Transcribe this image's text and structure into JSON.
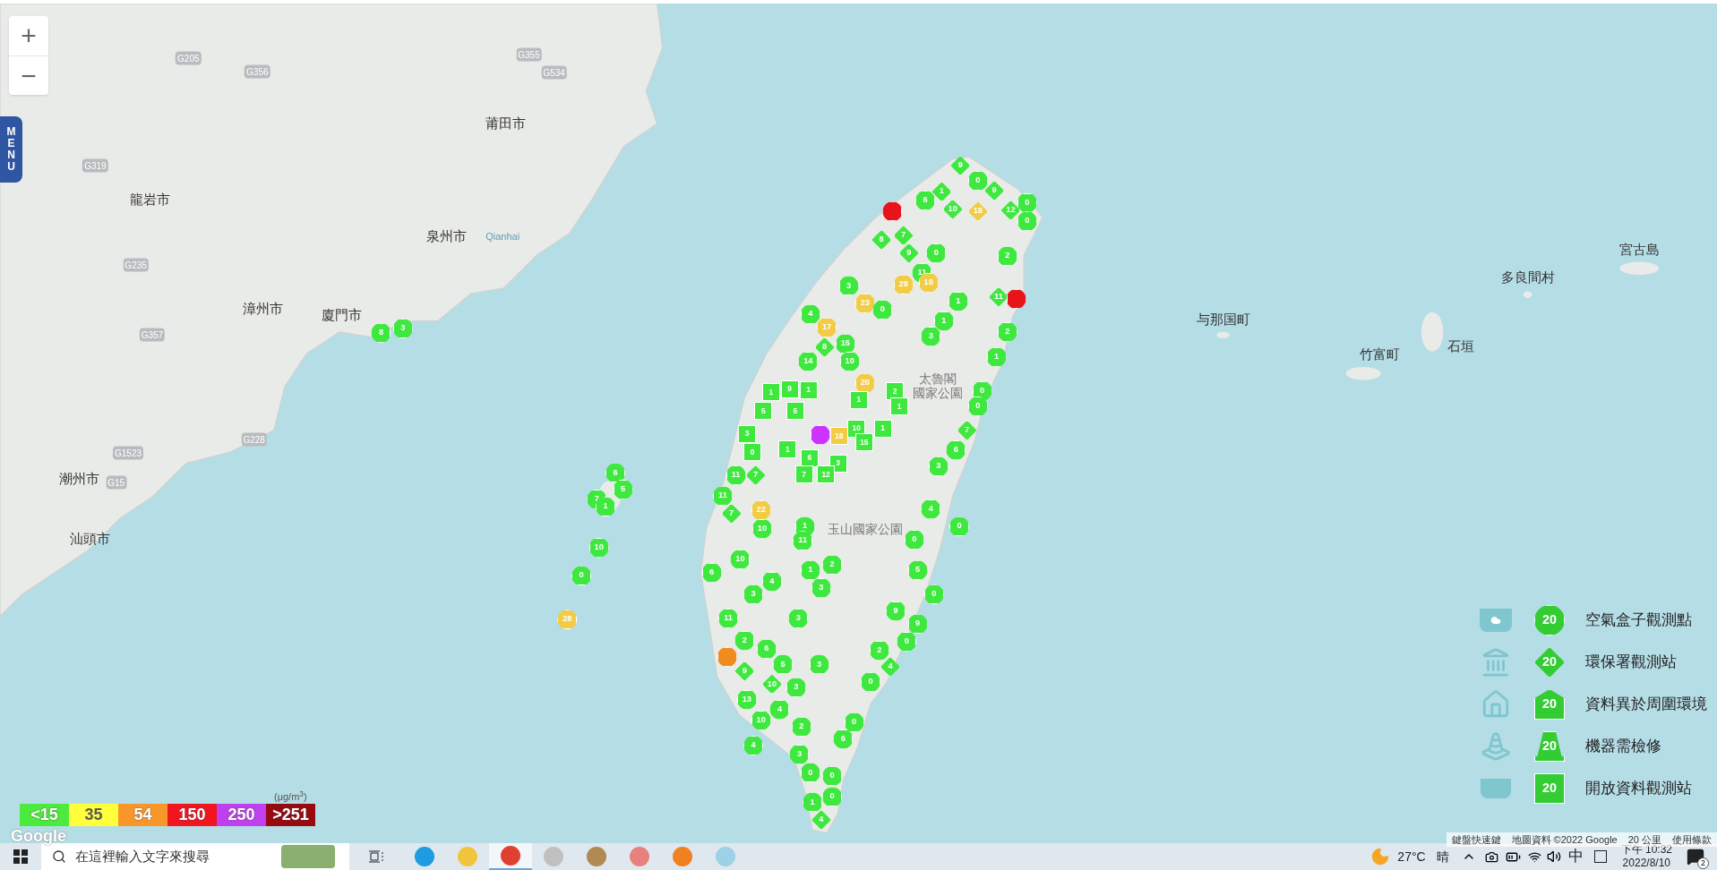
{
  "map": {
    "zoom_controls": {
      "zoom_in": "+",
      "zoom_out": "−"
    },
    "menu_button": "MENU",
    "places": [
      {
        "name": "莆田市",
        "kind": "city"
      },
      {
        "name": "龍岩市",
        "kind": "city"
      },
      {
        "name": "泉州市",
        "kind": "city"
      },
      {
        "name": "Qianhai",
        "kind": "water"
      },
      {
        "name": "漳州市",
        "kind": "city"
      },
      {
        "name": "廈門市",
        "kind": "city"
      },
      {
        "name": "潮州市",
        "kind": "city"
      },
      {
        "name": "汕頭市",
        "kind": "city"
      },
      {
        "name": "宮古島",
        "kind": "city"
      },
      {
        "name": "多良間村",
        "kind": "city"
      },
      {
        "name": "与那国町",
        "kind": "city"
      },
      {
        "name": "竹富町",
        "kind": "city"
      },
      {
        "name": "石垣",
        "kind": "city"
      },
      {
        "name": "太魯閣",
        "kind": "park"
      },
      {
        "name": "國家公園",
        "kind": "park"
      },
      {
        "name": "玉山國家公園",
        "kind": "park"
      },
      {
        "name": "G205",
        "kind": "road"
      },
      {
        "name": "G356",
        "kind": "road"
      },
      {
        "name": "G355",
        "kind": "road"
      },
      {
        "name": "G534",
        "kind": "road"
      },
      {
        "name": "G319",
        "kind": "road"
      },
      {
        "name": "G235",
        "kind": "road"
      },
      {
        "name": "G357",
        "kind": "road"
      },
      {
        "name": "G1523",
        "kind": "road"
      },
      {
        "name": "G15",
        "kind": "road"
      },
      {
        "name": "G228",
        "kind": "road"
      }
    ],
    "markers": [
      {
        "kind": "diamond",
        "value": "9",
        "color": "#3fe83f"
      },
      {
        "kind": "circle",
        "value": "0",
        "color": "#3fe83f"
      },
      {
        "kind": "diamond",
        "value": "9",
        "color": "#3fe83f"
      },
      {
        "kind": "diamond",
        "value": "12",
        "color": "#3fe83f"
      },
      {
        "kind": "circle",
        "value": "0",
        "color": "#3fe83f"
      },
      {
        "kind": "circle",
        "value": "0",
        "color": "#3fe83f"
      },
      {
        "kind": "diamond",
        "value": "10",
        "color": "#3fe83f"
      },
      {
        "kind": "diamond",
        "value": "18",
        "color": "#f2cc45"
      },
      {
        "kind": "diamond",
        "value": "1",
        "color": "#3fe83f"
      },
      {
        "kind": "circle",
        "value": "6",
        "color": "#3fe83f"
      },
      {
        "kind": "diamond",
        "value": "7",
        "color": "#3fe83f"
      },
      {
        "kind": "diamond",
        "value": "8",
        "color": "#3fe83f"
      },
      {
        "kind": "diamond",
        "value": "9",
        "color": "#3fe83f"
      },
      {
        "kind": "circle",
        "value": "11",
        "color": "#3fe83f"
      },
      {
        "kind": "circle",
        "value": "28",
        "color": "#f2cc45"
      },
      {
        "kind": "circle",
        "value": "18",
        "color": "#f2cc45"
      },
      {
        "kind": "circle",
        "value": "0",
        "color": "#3fe83f"
      },
      {
        "kind": "circle",
        "value": "2",
        "color": "#3fe83f"
      },
      {
        "kind": "diamond",
        "value": "11",
        "color": "#3fe83f"
      },
      {
        "kind": "circle",
        "value": "2",
        "color": "#3fe83f"
      },
      {
        "kind": "circle",
        "value": "0",
        "color": "#3fe83f"
      },
      {
        "kind": "circle",
        "value": "1",
        "color": "#3fe83f"
      },
      {
        "kind": "circle",
        "value": "1",
        "color": "#3fe83f"
      },
      {
        "kind": "circle",
        "value": "3",
        "color": "#3fe83f"
      },
      {
        "kind": "circle",
        "value": "3",
        "color": "#3fe83f"
      },
      {
        "kind": "circle",
        "value": "23",
        "color": "#f2cc45"
      },
      {
        "kind": "circle",
        "value": "0",
        "color": "#3fe83f"
      },
      {
        "kind": "circle",
        "value": "4",
        "color": "#3fe83f"
      },
      {
        "kind": "circle",
        "value": "17",
        "color": "#f2cc45"
      },
      {
        "kind": "diamond",
        "value": "8",
        "color": "#3fe83f"
      },
      {
        "kind": "circle",
        "value": "15",
        "color": "#3fe83f"
      },
      {
        "kind": "circle",
        "value": "14",
        "color": "#3fe83f"
      },
      {
        "kind": "circle",
        "value": "10",
        "color": "#3fe83f"
      },
      {
        "kind": "circle",
        "value": "20",
        "color": "#f2cc45"
      },
      {
        "kind": "square",
        "value": "2",
        "color": "#3fe83f"
      },
      {
        "kind": "square",
        "value": "1",
        "color": "#3fe83f"
      },
      {
        "kind": "square",
        "value": "1",
        "color": "#3fe83f"
      },
      {
        "kind": "square",
        "value": "10",
        "color": "#3fe83f"
      },
      {
        "kind": "square",
        "value": "1",
        "color": "#3fe83f"
      },
      {
        "kind": "square",
        "value": "15",
        "color": "#3fe83f"
      },
      {
        "kind": "square",
        "value": "18",
        "color": "#f2cc45"
      },
      {
        "kind": "square",
        "value": "1",
        "color": "#3fe83f"
      },
      {
        "kind": "square",
        "value": "9",
        "color": "#3fe83f"
      },
      {
        "kind": "square",
        "value": "1",
        "color": "#3fe83f"
      },
      {
        "kind": "square",
        "value": "5",
        "color": "#3fe83f"
      },
      {
        "kind": "square",
        "value": "5",
        "color": "#3fe83f"
      },
      {
        "kind": "square",
        "value": "3",
        "color": "#3fe83f"
      },
      {
        "kind": "square",
        "value": "0",
        "color": "#3fe83f"
      },
      {
        "kind": "square",
        "value": "1",
        "color": "#3fe83f"
      },
      {
        "kind": "square",
        "value": "6",
        "color": "#3fe83f"
      },
      {
        "kind": "square",
        "value": "3",
        "color": "#3fe83f"
      },
      {
        "kind": "circle",
        "value": "11",
        "color": "#3fe83f"
      },
      {
        "kind": "diamond",
        "value": "7",
        "color": "#3fe83f"
      },
      {
        "kind": "square",
        "value": "7",
        "color": "#3fe83f"
      },
      {
        "kind": "square",
        "value": "12",
        "color": "#3fe83f"
      },
      {
        "kind": "circle",
        "value": "11",
        "color": "#3fe83f"
      },
      {
        "kind": "diamond",
        "value": "7",
        "color": "#3fe83f"
      },
      {
        "kind": "circle",
        "value": "10",
        "color": "#3fe83f"
      },
      {
        "kind": "circle",
        "value": "1",
        "color": "#3fe83f"
      },
      {
        "kind": "circle",
        "value": "11",
        "color": "#3fe83f"
      },
      {
        "kind": "circle",
        "value": "22",
        "color": "#f2cc45"
      },
      {
        "kind": "circle",
        "value": "6",
        "color": "#3fe83f"
      },
      {
        "kind": "circle",
        "value": "10",
        "color": "#3fe83f"
      },
      {
        "kind": "circle",
        "value": "4",
        "color": "#3fe83f"
      },
      {
        "kind": "circle",
        "value": "1",
        "color": "#3fe83f"
      },
      {
        "kind": "circle",
        "value": "2",
        "color": "#3fe83f"
      },
      {
        "kind": "circle",
        "value": "3",
        "color": "#3fe83f"
      },
      {
        "kind": "circle",
        "value": "3",
        "color": "#3fe83f"
      },
      {
        "kind": "circle",
        "value": "11",
        "color": "#3fe83f"
      },
      {
        "kind": "circle",
        "value": "2",
        "color": "#3fe83f"
      },
      {
        "kind": "circle",
        "value": "6",
        "color": "#3fe83f"
      },
      {
        "kind": "circle",
        "value": "3",
        "color": "#3fe83f"
      },
      {
        "kind": "diamond",
        "value": "9",
        "color": "#3fe83f"
      },
      {
        "kind": "diamond",
        "value": "10",
        "color": "#3fe83f"
      },
      {
        "kind": "circle",
        "value": "5",
        "color": "#3fe83f"
      },
      {
        "kind": "circle",
        "value": "3",
        "color": "#3fe83f"
      },
      {
        "kind": "circle",
        "value": "3",
        "color": "#3fe83f"
      },
      {
        "kind": "circle",
        "value": "13",
        "color": "#3fe83f"
      },
      {
        "kind": "circle",
        "value": "10",
        "color": "#3fe83f"
      },
      {
        "kind": "circle",
        "value": "4",
        "color": "#3fe83f"
      },
      {
        "kind": "circle",
        "value": "2",
        "color": "#3fe83f"
      },
      {
        "kind": "circle",
        "value": "4",
        "color": "#3fe83f"
      },
      {
        "kind": "circle",
        "value": "3",
        "color": "#3fe83f"
      },
      {
        "kind": "circle",
        "value": "6",
        "color": "#3fe83f"
      },
      {
        "kind": "circle",
        "value": "0",
        "color": "#3fe83f"
      },
      {
        "kind": "circle",
        "value": "0",
        "color": "#3fe83f"
      },
      {
        "kind": "circle",
        "value": "0",
        "color": "#3fe83f"
      },
      {
        "kind": "circle",
        "value": "1",
        "color": "#3fe83f"
      },
      {
        "kind": "circle",
        "value": "0",
        "color": "#3fe83f"
      },
      {
        "kind": "diamond",
        "value": "4",
        "color": "#3fe83f"
      },
      {
        "kind": "circle",
        "value": "0",
        "color": "#3fe83f"
      },
      {
        "kind": "circle",
        "value": "4",
        "color": "#3fe83f"
      },
      {
        "kind": "circle",
        "value": "0",
        "color": "#3fe83f"
      },
      {
        "kind": "circle",
        "value": "3",
        "color": "#3fe83f"
      },
      {
        "kind": "circle",
        "value": "6",
        "color": "#3fe83f"
      },
      {
        "kind": "diamond",
        "value": "7",
        "color": "#3fe83f"
      },
      {
        "kind": "circle",
        "value": "0",
        "color": "#3fe83f"
      },
      {
        "kind": "circle",
        "value": "5",
        "color": "#3fe83f"
      },
      {
        "kind": "circle",
        "value": "0",
        "color": "#3fe83f"
      },
      {
        "kind": "circle",
        "value": "9",
        "color": "#3fe83f"
      },
      {
        "kind": "circle",
        "value": "9",
        "color": "#3fe83f"
      },
      {
        "kind": "circle",
        "value": "2",
        "color": "#3fe83f"
      },
      {
        "kind": "circle",
        "value": "0",
        "color": "#3fe83f"
      },
      {
        "kind": "diamond",
        "value": "4",
        "color": "#3fe83f"
      },
      {
        "kind": "circle",
        "value": "0",
        "color": "#3fe83f"
      },
      {
        "kind": "circle",
        "value": "6",
        "color": "#3fe83f"
      },
      {
        "kind": "circle",
        "value": "5",
        "color": "#3fe83f"
      },
      {
        "kind": "circle",
        "value": "7",
        "color": "#3fe83f"
      },
      {
        "kind": "circle",
        "value": "1",
        "color": "#3fe83f"
      },
      {
        "kind": "circle",
        "value": "10",
        "color": "#3fe83f"
      },
      {
        "kind": "circle",
        "value": "0",
        "color": "#3fe83f"
      },
      {
        "kind": "circle",
        "value": "28",
        "color": "#f2cc45"
      },
      {
        "kind": "circle",
        "value": "8",
        "color": "#3fe83f"
      },
      {
        "kind": "circle",
        "value": "3",
        "color": "#3fe83f"
      },
      {
        "kind": "circle",
        "value": "1",
        "color": "#3fe83f"
      },
      {
        "kind": "circle",
        "color": "#e8141c"
      },
      {
        "kind": "circle",
        "color": "#e8141c"
      },
      {
        "kind": "circle",
        "color": "#cc33ff"
      },
      {
        "kind": "circle",
        "color": "#f08c1e"
      }
    ],
    "pm_scale": {
      "unit": "(μg/m$^{3}$)",
      "levels": [
        {
          "label": "<15",
          "color": "#4cea3c"
        },
        {
          "label": "35",
          "color": "#ffff3c"
        },
        {
          "label": "54",
          "color": "#f8962a"
        },
        {
          "label": "150",
          "color": "#f2141e"
        },
        {
          "label": "250",
          "color": "#c040f0"
        },
        {
          "label": ">251",
          "color": "#960a10"
        }
      ]
    },
    "station_legend": [
      {
        "kind": "circle",
        "value": "20",
        "label": "空氣盒子觀測點"
      },
      {
        "kind": "diamond",
        "value": "20",
        "label": "環保署觀測站"
      },
      {
        "kind": "house",
        "value": "20",
        "label": "資料異於周圍環境"
      },
      {
        "kind": "cone",
        "value": "20",
        "label": "機器需檢修"
      },
      {
        "kind": "square",
        "value": "20",
        "label": "開放資料觀測站"
      }
    ],
    "google_logo": "Google",
    "attribution": [
      "鍵盤快速鍵",
      "地圖資料 ©2022 Google",
      "20 公里",
      "使用條款"
    ]
  },
  "taskbar": {
    "search": {
      "placeholder": "在這裡輸入文字來搜尋"
    },
    "apps": [
      {
        "selected": false
      },
      {
        "selected": false
      },
      {
        "selected": true
      },
      {
        "selected": false
      },
      {
        "selected": false
      },
      {
        "selected": false
      },
      {
        "selected": false
      },
      {
        "selected": false
      }
    ],
    "temperature": "27°C",
    "weather": "晴",
    "ime": "中",
    "time": "下午 10:32",
    "date": "2022/8/10",
    "notifications": "2"
  }
}
